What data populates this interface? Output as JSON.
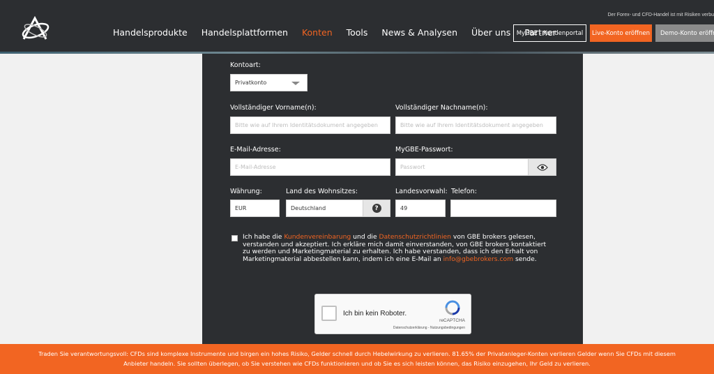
{
  "header": {
    "risk_note": "Der Forex- und CFD-Handel ist mit Risiken verbu",
    "nav": [
      "Handelsprodukte",
      "Handelsplattformen",
      "Konten",
      "Tools",
      "News & Analysen",
      "Über uns",
      "Partner"
    ],
    "active_nav": "Konten",
    "portal_button": "MyGBE - Kundenportal",
    "live_button": "Live-Konto eröffnen",
    "demo_button": "Demo-Konto eröffn"
  },
  "form": {
    "account_type": {
      "label": "Kontoart:",
      "value": "Privatkonto"
    },
    "first_name": {
      "label": "Vollständiger Vorname(n):",
      "placeholder": "Bitte wie auf Ihrem Identitätsdokument angegeben"
    },
    "last_name": {
      "label": "Vollständiger Nachname(n):",
      "placeholder": "Bitte wie auf Ihrem Identitätsdokument angegeben"
    },
    "email": {
      "label": "E-Mail-Adresse:",
      "placeholder": "E-Mail-Adresse"
    },
    "password": {
      "label": "MyGBE-Passwort:",
      "placeholder": "Passwort"
    },
    "currency": {
      "label": "Währung:",
      "value": "EUR"
    },
    "country": {
      "label": "Land des Wohnsitzes:",
      "value": "Deutschland"
    },
    "dial_code": {
      "label": "Landesvorwahl:",
      "value": "49"
    },
    "phone": {
      "label": "Telefon:",
      "value": ""
    },
    "consent": {
      "t1": "Ich habe die ",
      "link1": "Kundenvereinbarung",
      "t2": " und die ",
      "link2": "Datenschutzrichtlinien",
      "t3": " von GBE brokers gelesen, verstanden und akzeptiert. Ich erkläre mich damit einverstanden, von GBE brokers kontaktiert zu werden und Marketingmaterial zu erhalten. Ich habe verstanden, dass ich den Erhalt von Marketingmaterial abbestellen kann, indem ich eine E-Mail an ",
      "email_link": "info@gbebrokers.com",
      "t4": " sende."
    }
  },
  "captcha": {
    "label": "Ich bin kein Roboter.",
    "brand": "reCAPTCHA",
    "links": "Datenschutzerklärung - Nutzungsbedingungen"
  },
  "banner": {
    "text": "Traden Sie verantwortungsvoll: CFDs sind komplexe Instrumente und birgen ein hohes Risiko, Gelder schnell durch Hebelwirkung zu verlieren. 81.65% der Privatanleger-Konten verlieren Gelder wenn Sie CFDs mit diesem Anbieter handeln. Sie sollten überlegen, ob Sie verstehen wie CFDs funktionieren und ob Sie es sich leisten können, das Risiko einzugehen, Ihr Geld zu verlieren."
  },
  "colors": {
    "accent": "#f26522",
    "panel": "#2c2e31",
    "header": "#2c2e31"
  },
  "icons": {
    "logo": "gbe-logo-icon",
    "password_toggle": "eye-icon",
    "country_help": "question-icon",
    "captcha": "recaptcha-icon"
  }
}
